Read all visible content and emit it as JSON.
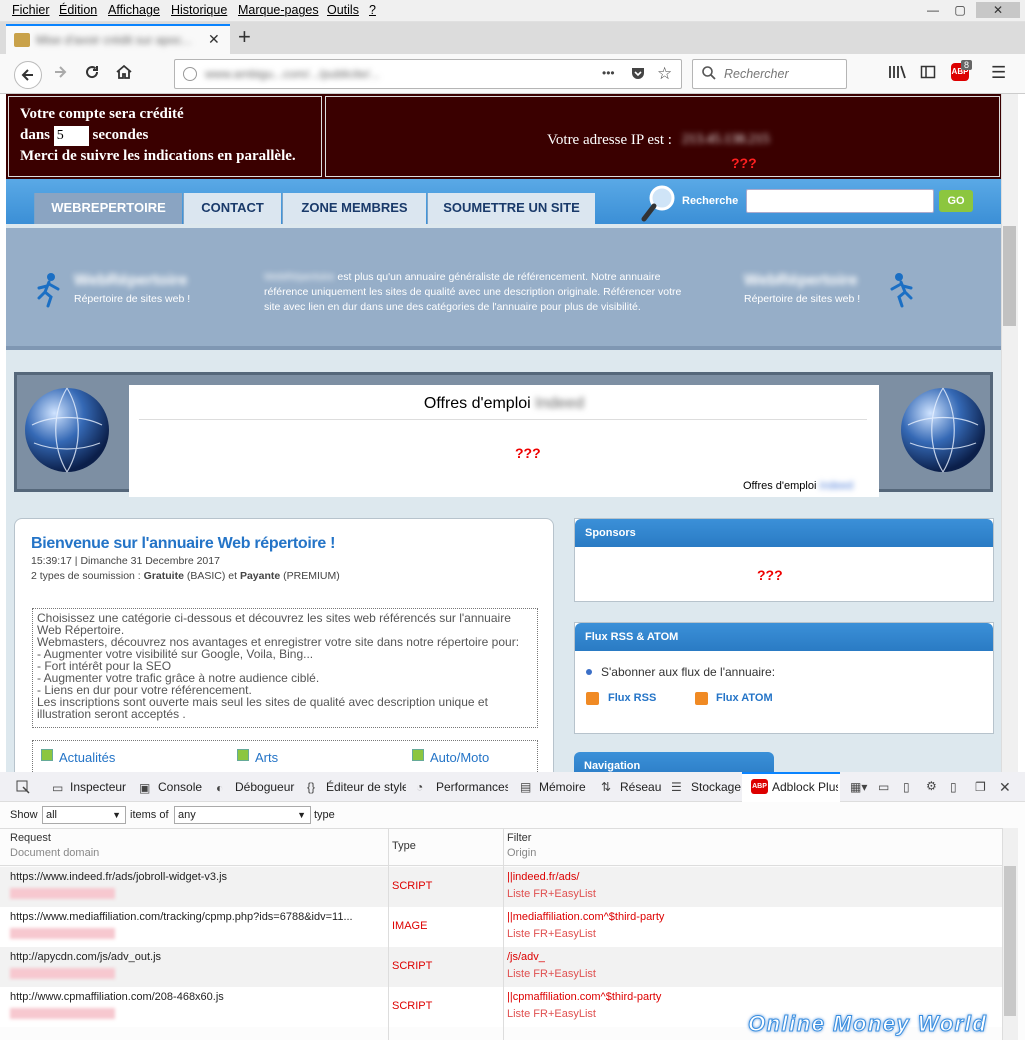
{
  "menubar": {
    "items": [
      "Fichier",
      "Édition",
      "Affichage",
      "Historique",
      "Marque-pages",
      "Outils",
      "?"
    ],
    "minimize": "—",
    "maximize": "▢",
    "close": "✕"
  },
  "tab": {
    "title": "Mise d'avoir crédit sur apoc...",
    "close": "✕",
    "new": "+"
  },
  "navbar": {
    "url": "www.ambigu...com/.../publicite/...",
    "more": "•••",
    "search_placeholder": "Rechercher",
    "abp_count": "8"
  },
  "banner": {
    "line1": "Votre compte sera crédité",
    "line2_pre": "dans",
    "countdown": "5",
    "line2_post": "secondes",
    "line3": "Merci de suivre les indications en parallèle.",
    "ip_label": "Votre adresse IP est :",
    "ip_value": "213.45.138.215",
    "ip_q": "???"
  },
  "site_menu": {
    "tabs": [
      "WEBREPERTOIRE",
      "CONTACT",
      "ZONE MEMBRES",
      "SOUMETTRE UN SITE"
    ],
    "search_label": "Recherche",
    "go": "GO"
  },
  "hero": {
    "brand": "WebRépertoire",
    "tagline": "Répertoire de sites web !",
    "text_brand": "WebRépertoire",
    "text": "est plus qu'un annuaire généraliste de référencement. Notre annuaire référence uniquement les sites de qualité avec une description originale. Référencer votre site avec lien en dur dans une des catégories de l'annuaire pour plus de visibilité."
  },
  "jobs": {
    "title": "Offres d'emploi",
    "title_brand": "Indeed",
    "q": "???",
    "footer": "Offres d'emploi",
    "footer_brand": "Indeed"
  },
  "welcome": {
    "title": "Bienvenue sur l'annuaire Web répertoire !",
    "time": "15:39:17",
    "date": "Dimanche 31 Decembre 2017",
    "types_pre": "2 types de soumission :",
    "t1": "Gratuite",
    "t1b": "(BASIC) et",
    "t2": "Payante",
    "t2b": "(PREMIUM)",
    "desc": [
      "Choisissez une catégorie ci-dessous et découvrez les sites web référencés sur l'annuaire",
      "Web Répertoire.",
      "Webmasters, découvrez nos avantages et enregistrer votre site dans notre répertoire pour:",
      "- Augmenter votre visibilité sur Google, Voila, Bing...",
      "- Fort intérêt pour la SEO",
      "- Augmenter votre trafic grâce à notre audience ciblé.",
      "- Liens en dur pour votre référencement.",
      "Les inscriptions sont ouverte mais seul les sites de qualité avec description unique et",
      "illustration seront acceptés ."
    ],
    "categories": [
      "Actualités",
      "Arts",
      "Auto/Moto"
    ]
  },
  "sponsors": {
    "title": "Sponsors",
    "q": "???"
  },
  "rss": {
    "title": "Flux RSS & ATOM",
    "subscribe": "S'abonner aux flux de l'annuaire:",
    "rss": "Flux RSS",
    "atom": "Flux ATOM"
  },
  "navigation": {
    "title": "Navigation"
  },
  "devtools": {
    "tabs": [
      "Inspecteur",
      "Console",
      "Débogueur",
      "Éditeur de style",
      "Performances",
      "Mémoire",
      "Réseau",
      "Stockage",
      "Adblock Plus"
    ],
    "show_label": "Show",
    "show_value": "all",
    "items_of": "items of",
    "any_value": "any",
    "type_label": "type",
    "col_request": "Request",
    "col_domain": "Document domain",
    "col_type": "Type",
    "col_filter": "Filter",
    "col_origin": "Origin",
    "rows": [
      {
        "request": "https://www.indeed.fr/ads/jobroll-widget-v3.js",
        "type": "SCRIPT",
        "filter": "||indeed.fr/ads/",
        "origin": "Liste FR+EasyList"
      },
      {
        "request": "https://www.mediaffiliation.com/tracking/cpmp.php?ids=6788&idv=11...",
        "type": "IMAGE",
        "filter": "||mediaffiliation.com^$third-party",
        "origin": "Liste FR+EasyList"
      },
      {
        "request": "http://apycdn.com/js/adv_out.js",
        "type": "SCRIPT",
        "filter": "/js/adv_",
        "origin": "Liste FR+EasyList"
      },
      {
        "request": "http://www.cpmaffiliation.com/208-468x60.js",
        "type": "SCRIPT",
        "filter": "||cpmaffiliation.com^$third-party",
        "origin": "Liste FR+EasyList"
      }
    ]
  },
  "watermark": "Online Money World",
  "colors": {
    "accent": "#0a84ff",
    "banner": "#3a0000",
    "menu": "#3b8fd6",
    "alert": "#e00000"
  }
}
